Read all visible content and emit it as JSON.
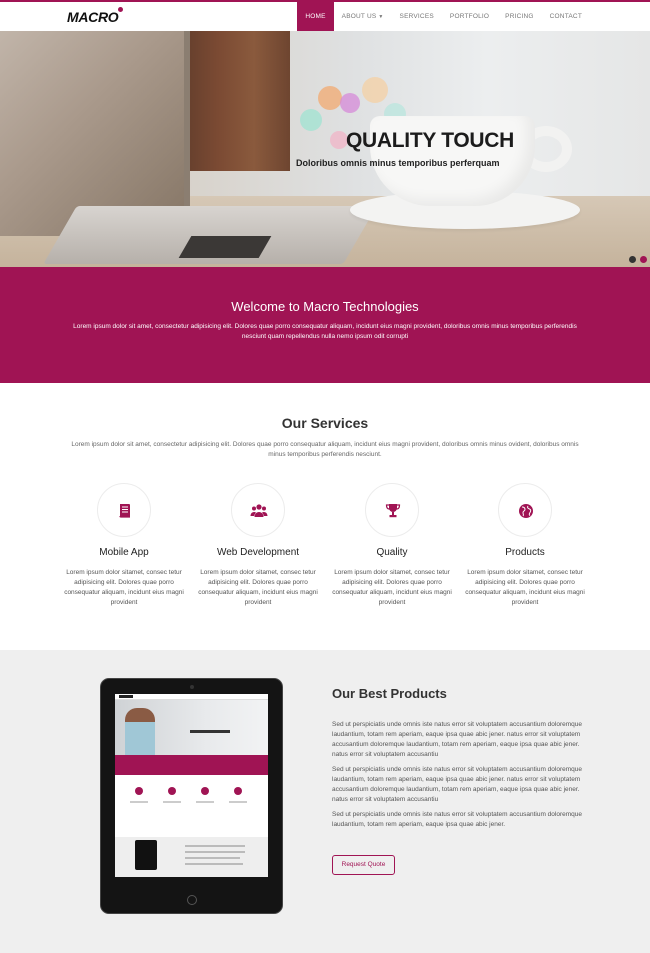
{
  "brand": {
    "name": "MACRO",
    "accent": "#a01454"
  },
  "nav": {
    "items": [
      {
        "label": "HOME",
        "active": true
      },
      {
        "label": "ABOUT US",
        "dropdown": true
      },
      {
        "label": "SERVICES"
      },
      {
        "label": "PORTFOLIO"
      },
      {
        "label": "PRICING"
      },
      {
        "label": "CONTACT"
      }
    ]
  },
  "hero": {
    "title": "QUALITY TOUCH",
    "subtitle": "Doloribus omnis minus temporibus perferquam"
  },
  "welcome": {
    "title": "Welcome to Macro Technologies",
    "text": "Lorem ipsum dolor sit amet, consectetur adipisicing elit. Dolores quae porro consequatur aliquam, incidunt eius magni provident, doloribus omnis minus temporibus perferendis nesciunt quam repellendus nulla nemo ipsum odit corrupti"
  },
  "services": {
    "title": "Our Services",
    "intro": "Lorem ipsum dolor sit amet, consectetur adipisicing elit. Dolores quae porro consequatur aliquam, incidunt eius magni provident, doloribus omnis minus ovident, doloribus omnis minus temporibus perferendis nesciunt.",
    "items": [
      {
        "icon": "book-icon",
        "title": "Mobile App",
        "text": "Lorem ipsum dolor sitamet, consec tetur adipisicing elit. Dolores quae porro consequatur aliquam, incidunt eius magni provident"
      },
      {
        "icon": "users-icon",
        "title": "Web Development",
        "text": "Lorem ipsum dolor sitamet, consec tetur adipisicing elit. Dolores quae porro consequatur aliquam, incidunt eius magni provident"
      },
      {
        "icon": "trophy-icon",
        "title": "Quality",
        "text": "Lorem ipsum dolor sitamet, consec tetur adipisicing elit. Dolores quae porro consequatur aliquam, incidunt eius magni provident"
      },
      {
        "icon": "globe-icon",
        "title": "Products",
        "text": "Lorem ipsum dolor sitamet, consec tetur adipisicing elit. Dolores quae porro consequatur aliquam, incidunt eius magni provident"
      }
    ]
  },
  "products": {
    "title": "Our Best Products",
    "paragraphs": [
      "Sed ut perspiciatis unde omnis iste natus error sit voluptatem accusantium doloremque laudantium, totam rem aperiam, eaque ipsa quae abic jener. natus error sit voluptatem accusantium doloremque laudantium, totam rem aperiam, eaque ipsa quae abic jener. natus error sit voluptatem accusantiu",
      "Sed ut perspiciatis unde omnis iste natus error sit voluptatem accusantium doloremque laudantium, totam rem aperiam, eaque ipsa quae abic jener. natus error sit voluptatem accusantium doloremque laudantium, totam rem aperiam, eaque ipsa quae abic jener. natus error sit voluptatem accusantiu",
      "Sed ut perspiciatis unde omnis iste natus error sit voluptatem accusantium doloremque laudantium, totam rem aperiam, eaque ipsa quae abic jener."
    ],
    "button": "Request Quote"
  }
}
